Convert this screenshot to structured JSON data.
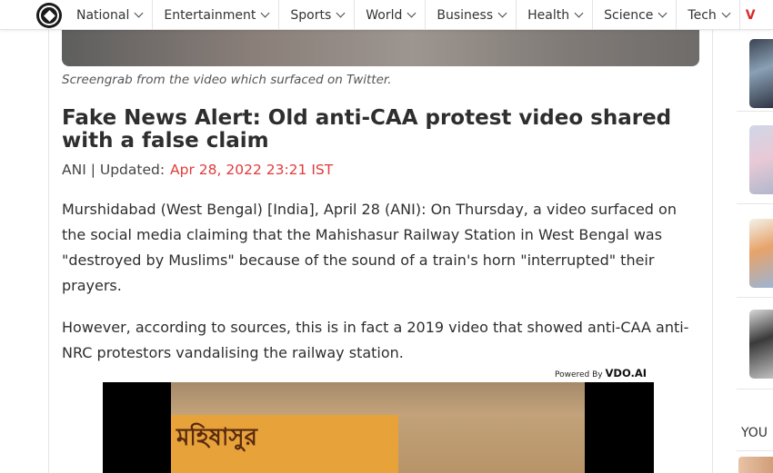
{
  "nav": {
    "items": [
      {
        "label": "National"
      },
      {
        "label": "Entertainment"
      },
      {
        "label": "Sports"
      },
      {
        "label": "World"
      },
      {
        "label": "Business"
      },
      {
        "label": "Health"
      },
      {
        "label": "Science"
      },
      {
        "label": "Tech"
      }
    ],
    "partial_label": "V",
    "logo_icon": "site-logo-icon"
  },
  "article": {
    "caption": "Screengrab from the video which surfaced on Twitter.",
    "headline": "Fake News Alert: Old anti-CAA protest video shared with a false claim",
    "byline_source": "ANI | Updated:",
    "byline_date": "Apr 28, 2022 23:21 IST",
    "paragraph1": "Murshidabad (West Bengal) [India], April 28 (ANI): On Thursday, a video surfaced on the social media claiming that the Mahishasur Railway Station in West Bengal was \"destroyed by Muslims\" because of the sound of a train's horn \"interrupted\" their prayers.",
    "paragraph2": "However, according to sources, this is in fact a 2019 video that showed anti-CAA anti-NRC protestors vandalising the railway station.",
    "powered_by": "Powered By",
    "powered_brand": "VDO.AI",
    "video_sign_text": "মহিষাসুর"
  },
  "sidebar": {
    "section_label": "YOU"
  },
  "colors": {
    "accent_red": "#e23b3b",
    "text_dark": "#2e2e2e"
  }
}
